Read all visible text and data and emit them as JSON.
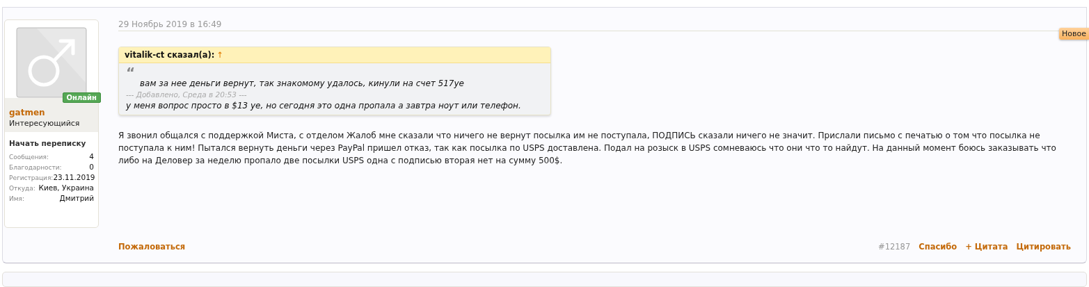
{
  "user": {
    "name": "gatmen",
    "title": "Интересующийся",
    "online_badge": "Онлайн",
    "online": true,
    "start_conversation": "Начать переписку",
    "stats": [
      {
        "label": "Сообщения:",
        "value": "4"
      },
      {
        "label": "Благодарности:",
        "value": "0"
      },
      {
        "label": "Регистрация:",
        "value": "23.11.2019"
      },
      {
        "label": "Откуда:",
        "value": "Киев, Украина"
      },
      {
        "label": "Имя:",
        "value": "Дмитрий"
      }
    ]
  },
  "post": {
    "date": "29 Ноябрь 2019 в 16:49",
    "new_badge": "Новое",
    "quote": {
      "author": "vitalik-ct сказал(а):",
      "jump": "↑",
      "mark": "“",
      "text": "вам за нее деньги вернут, так знакомому удалось, кинули на счет 517уе",
      "added": "--- Добавлено, Среда в 20:53 ---",
      "text2": "у меня вопрос просто в $13 уе, но сегодня это одна пропала а завтра ноут или телефон."
    },
    "body": "Я звонил общался с поддержкой Миста, с отделом Жалоб мне сказали что ничего не вернут посылка им не поступала, ПОДПИСЬ сказали ничего не значит. Прислали письмо с печатью о том что посылка не поступала к ним! Пытался вернуть деньги через PayPal пришел отказ, так как посылка по USPS доставлена. Подал на розыск в USPS сомневаюсь что они что то найдут. На данный момент боюсь заказывать что либо на Деловер за неделю пропало две посылки USPS одна с подписью вторая нет на сумму 500$.",
    "report": "Пожаловаться",
    "number": "#12187",
    "actions": [
      "Спасибо",
      "+ Цитата",
      "Цитировать"
    ]
  }
}
